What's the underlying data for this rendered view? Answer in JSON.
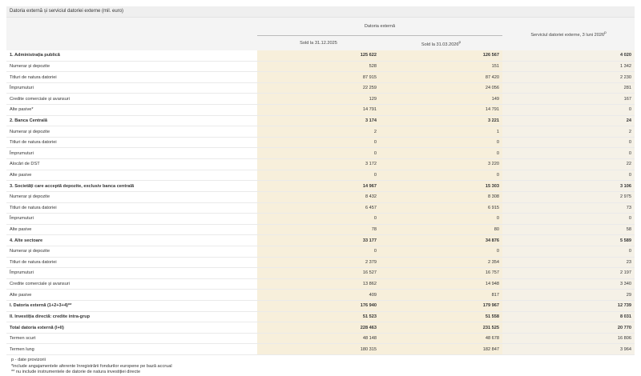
{
  "title": "Datoria externă și serviciul datoriei externe (mil. euro)",
  "header": {
    "group": "Datoria externă",
    "col1": "Sold la 31.12.2025",
    "col2": "Sold la 31.03.2026",
    "col2_sup": "p",
    "col3": "Serviciul datoriei externe, 3 luni 2026",
    "col3_sup": "p"
  },
  "rows": [
    {
      "label": "1. Administrația publică",
      "v1": "125 622",
      "v2": "126 567",
      "v3": "4 020",
      "bold": true
    },
    {
      "label": "Numerar și depozite",
      "v1": "528",
      "v2": "151",
      "v3": "1 342"
    },
    {
      "label": "Titluri de natura datoriei",
      "v1": "87 915",
      "v2": "87 420",
      "v3": "2 230"
    },
    {
      "label": "Împrumuturi",
      "v1": "22 259",
      "v2": "24 056",
      "v3": "281"
    },
    {
      "label": "Credite comerciale și avansuri",
      "v1": "129",
      "v2": "149",
      "v3": "167"
    },
    {
      "label": "Alte pasive*",
      "v1": "14 791",
      "v2": "14 791",
      "v3": "0"
    },
    {
      "label": "2. Banca Centrală",
      "v1": "3 174",
      "v2": "3 221",
      "v3": "24",
      "bold": true
    },
    {
      "label": "Numerar și depozite",
      "v1": "2",
      "v2": "1",
      "v3": "2"
    },
    {
      "label": "Titluri de natura datoriei",
      "v1": "0",
      "v2": "0",
      "v3": "0"
    },
    {
      "label": "Împrumuturi",
      "v1": "0",
      "v2": "0",
      "v3": "0"
    },
    {
      "label": "Alocări de DST",
      "v1": "3 172",
      "v2": "3 220",
      "v3": "22"
    },
    {
      "label": "Alte pasive",
      "v1": "0",
      "v2": "0",
      "v3": "0"
    },
    {
      "label": "3. Societăți care acceptă depozite, exclusiv banca centrală",
      "v1": "14 967",
      "v2": "15 303",
      "v3": "3 106",
      "bold": true
    },
    {
      "label": "Numerar și depozite",
      "v1": "8 432",
      "v2": "8 308",
      "v3": "2 975"
    },
    {
      "label": "Titluri de natura datoriei",
      "v1": "6 457",
      "v2": "6 915",
      "v3": "73"
    },
    {
      "label": "Împrumuturi",
      "v1": "0",
      "v2": "0",
      "v3": "0"
    },
    {
      "label": "Alte pasive",
      "v1": "78",
      "v2": "80",
      "v3": "58"
    },
    {
      "label": "4. Alte sectoare",
      "v1": "33 177",
      "v2": "34 876",
      "v3": "5 589",
      "bold": true
    },
    {
      "label": "Numerar și depozite",
      "v1": "0",
      "v2": "0",
      "v3": "0"
    },
    {
      "label": "Titluri de natura datoriei",
      "v1": "2 379",
      "v2": "2 354",
      "v3": "23"
    },
    {
      "label": "Împrumuturi",
      "v1": "16 527",
      "v2": "16 757",
      "v3": "2 197"
    },
    {
      "label": "Credite comerciale și avansuri",
      "v1": "13 862",
      "v2": "14 948",
      "v3": "3 340"
    },
    {
      "label": "Alte pasive",
      "v1": "409",
      "v2": "817",
      "v3": "29"
    },
    {
      "label": "I. Datoria externă (1+2+3+4)**",
      "v1": "176 940",
      "v2": "179 967",
      "v3": "12 739",
      "bold": true
    },
    {
      "label": "II. Investiția directă: credite intra-grup",
      "v1": "51 523",
      "v2": "51 558",
      "v3": "8 031",
      "bold": true
    },
    {
      "label": "Total datoria externă (I+II)",
      "v1": "228 463",
      "v2": "231 525",
      "v3": "20 770",
      "bold": true
    },
    {
      "label": "Termen scurt",
      "v1": "48 148",
      "v2": "48 678",
      "v3": "16 806"
    },
    {
      "label": "Termen lung",
      "v1": "180 315",
      "v2": "182 847",
      "v3": "3 964"
    }
  ],
  "notes": [
    "p - date provizorii",
    "*include angajamentele aferente înregistrării fondurilor europene pe bază accrual",
    "** nu include instrumentele de datorie de natura investiției directe"
  ]
}
